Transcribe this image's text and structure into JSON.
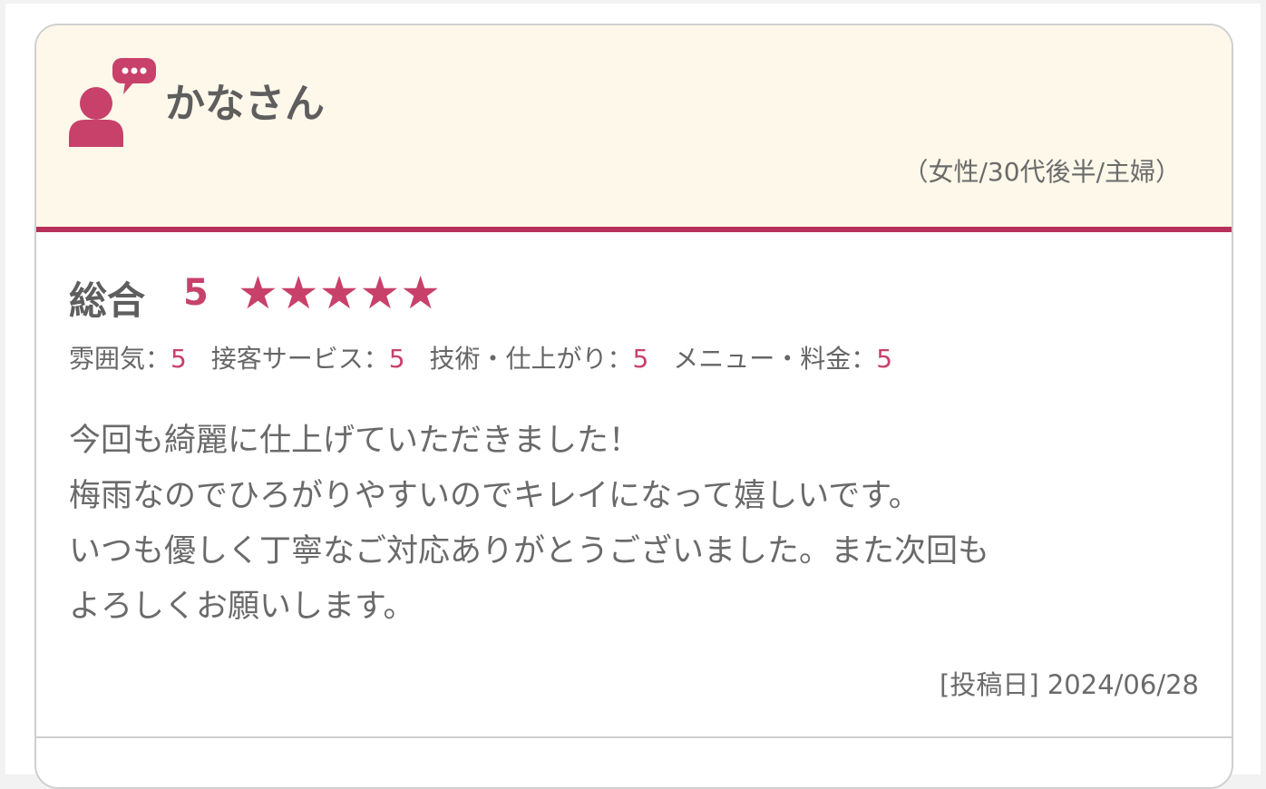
{
  "review": {
    "name": "かなさん",
    "profile": "（女性/30代後半/主婦）",
    "overall_label": "総合",
    "overall_score": "5",
    "stars": "★★★★★",
    "rating_count": 5,
    "sub_ratings": [
      {
        "label": "雰囲気：",
        "value": "5"
      },
      {
        "label": "接客サービス：",
        "value": "5"
      },
      {
        "label": "技術・仕上がり：",
        "value": "5"
      },
      {
        "label": "メニュー・料金：",
        "value": "5"
      }
    ],
    "comment_lines": [
      "今回も綺麗に仕上げていただきました！",
      "梅雨なのでひろがりやすいのでキレイになって嬉しいです。",
      "いつも優しく丁寧なご対応ありがとうございました。また次回も",
      "よろしくお願いします。"
    ],
    "date": "[投稿日] 2024/06/28"
  },
  "icons": {
    "reviewer": "user-speech-bubble-icon"
  },
  "colors": {
    "accent": "#c8416b",
    "header_bg": "#fdf8e9",
    "header_border": "#b8315a"
  }
}
